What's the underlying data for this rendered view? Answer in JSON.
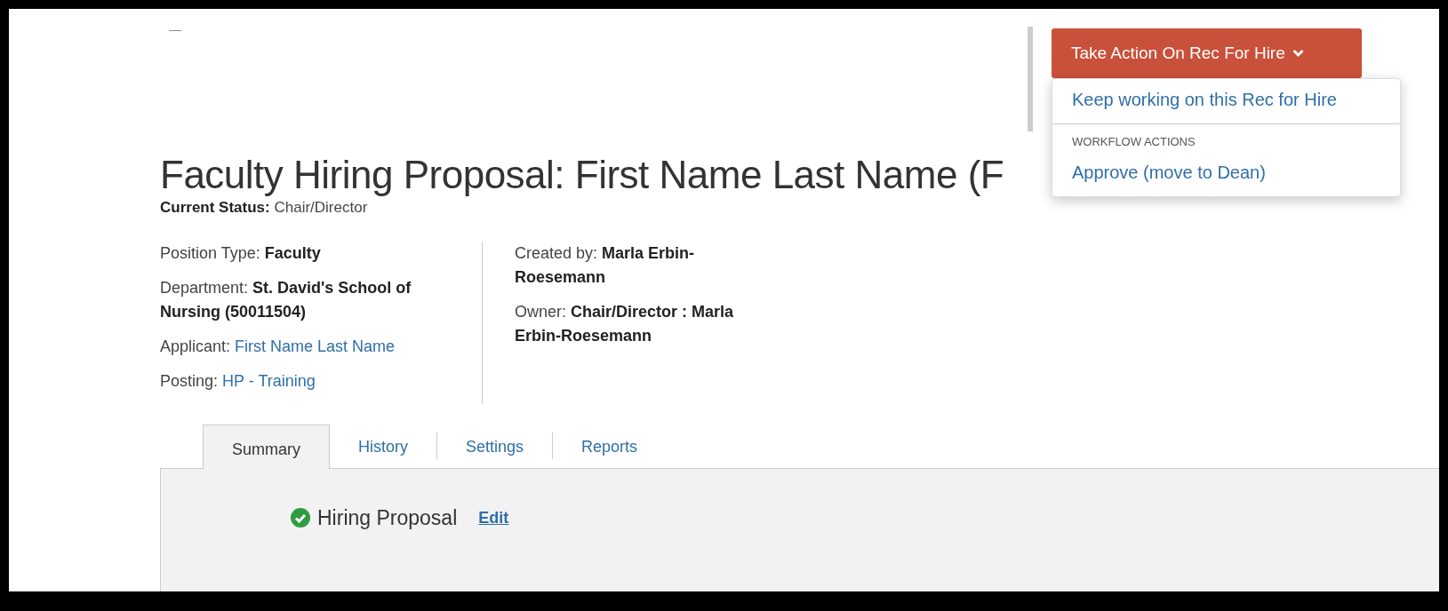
{
  "title": "Faculty Hiring Proposal: First Name Last Name (F",
  "current_status": {
    "label": "Current Status:",
    "value": "Chair/Director"
  },
  "details_left": [
    {
      "label": "Position Type:",
      "value": "Faculty",
      "kind": "bold"
    },
    {
      "label": "Department:",
      "value": "St. David's School of Nursing (50011504)",
      "kind": "bold"
    },
    {
      "label": "Applicant:",
      "value": "First Name Last Name",
      "kind": "link"
    },
    {
      "label": "Posting:",
      "value": "HP - Training",
      "kind": "link"
    }
  ],
  "details_right": [
    {
      "label": "Created by:",
      "value": "Marla Erbin-Roesemann",
      "kind": "bold"
    },
    {
      "label": "Owner:",
      "value": "Chair/Director : Marla Erbin-Roesemann",
      "kind": "bold"
    }
  ],
  "action_menu": {
    "button": "Take Action On Rec For Hire",
    "expanded": true,
    "items": [
      {
        "kind": "link",
        "text": "Keep working on this Rec for Hire"
      },
      {
        "kind": "header",
        "text": "WORKFLOW ACTIONS"
      },
      {
        "kind": "link",
        "text": "Approve (move to Dean)"
      }
    ]
  },
  "tabs": [
    {
      "label": "Summary",
      "selected": true
    },
    {
      "label": "History",
      "selected": false
    },
    {
      "label": "Settings",
      "selected": false
    },
    {
      "label": "Reports",
      "selected": false
    }
  ],
  "sections": [
    {
      "title": "Hiring Proposal",
      "complete": true,
      "action": "Edit"
    }
  ]
}
